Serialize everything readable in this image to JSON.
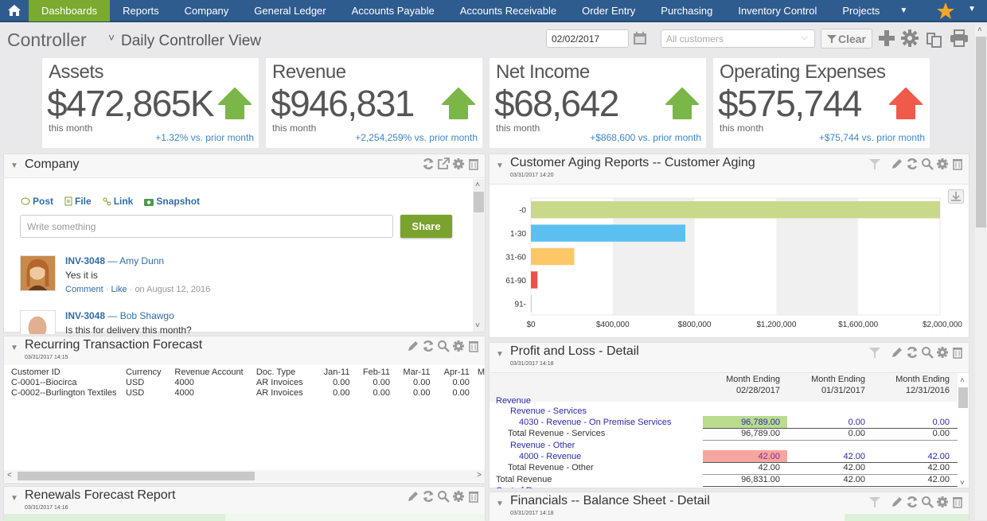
{
  "nav": {
    "home_icon": "home-icon",
    "items": [
      "Dashboards",
      "Reports",
      "Company",
      "General Ledger",
      "Accounts Payable",
      "Accounts Receivable",
      "Order Entry",
      "Purchasing",
      "Inventory Control",
      "Projects"
    ],
    "active": "Dashboards",
    "more_icon": "caret-down-icon",
    "favorites_icon": "star-icon"
  },
  "header": {
    "title": "Controller",
    "view": "Daily Controller View",
    "date": "02/02/2017",
    "customer_filter": "All customers",
    "clear_label": "Clear"
  },
  "kpis": [
    {
      "label": "Assets",
      "value": "$472,865K",
      "sub": "this month",
      "change": "+1.32% vs. prior month",
      "trend": "up",
      "color": "#7ab648"
    },
    {
      "label": "Revenue",
      "value": "$946,831",
      "sub": "this month",
      "change": "+2,254,259% vs. prior month",
      "trend": "up",
      "color": "#7ab648"
    },
    {
      "label": "Net Income",
      "value": "$68,642",
      "sub": "this month",
      "change": "+$868,600 vs. prior month",
      "trend": "up",
      "color": "#7ab648"
    },
    {
      "label": "Operating Expenses",
      "value": "$575,744",
      "sub": "this month",
      "change": "+$75,744 vs. prior month",
      "trend": "up",
      "color": "#f05a4a"
    }
  ],
  "company": {
    "title": "Company",
    "tabs": [
      "Post",
      "File",
      "Link",
      "Snapshot"
    ],
    "placeholder": "Write something",
    "share_label": "Share",
    "posts": [
      {
        "ref": "INV-3048",
        "author": "Amy Dunn",
        "text": "Yes it is",
        "comment": "Comment",
        "like": "Like",
        "date": "on August 12, 2016"
      },
      {
        "ref": "INV-3048",
        "author": "Bob Shawgo",
        "text": "Is this for delivery this month?"
      }
    ]
  },
  "aging": {
    "title": "Customer Aging Reports -- Customer Aging",
    "timestamp": "03/31/2017 14:20"
  },
  "chart_data": {
    "type": "bar",
    "orientation": "horizontal",
    "title": "Customer Aging Reports -- Customer Aging",
    "categories": [
      "-0",
      "1-30",
      "31-60",
      "61-90",
      "91-"
    ],
    "values": [
      2000000,
      755000,
      212000,
      32000,
      2000
    ],
    "colors": [
      "#c9d98a",
      "#5bc0f0",
      "#fdc767",
      "#f0504a",
      "#cccccc"
    ],
    "xlim": [
      0,
      2000000
    ],
    "xticks": [
      "$0",
      "$400,000",
      "$800,000",
      "$1,200,000",
      "$1,600,000",
      "$2,000,000"
    ],
    "xtick_values": [
      0,
      400000,
      800000,
      1200000,
      1600000,
      2000000
    ],
    "xlabel": "",
    "ylabel": "",
    "grid": "alternating vertical bands"
  },
  "recurring": {
    "title": "Recurring Transaction Forecast",
    "timestamp": "03/31/2017 14:15",
    "columns": [
      "Customer ID",
      "Currency",
      "Revenue Account",
      "Doc. Type",
      "Jan-11",
      "Feb-11",
      "Mar-11",
      "Apr-11",
      "M"
    ],
    "rows": [
      [
        "C-0001--Biocirca",
        "USD",
        "4000",
        "AR Invoices",
        "0.00",
        "0.00",
        "0.00",
        "0.00"
      ],
      [
        "C-0002--Burlington Textiles",
        "USD",
        "4000",
        "AR Invoices",
        "0.00",
        "0.00",
        "0.00",
        "0.00"
      ]
    ]
  },
  "renewals": {
    "title": "Renewals Forecast Report",
    "timestamp": "03/31/2017 14:16"
  },
  "pnl": {
    "title": "Profit and Loss - Detail",
    "timestamp": "03/31/2017 14:18",
    "col_head": "Month Ending",
    "columns": [
      "02/28/2017",
      "01/31/2017",
      "12/31/2016"
    ],
    "rows": [
      {
        "label": "Revenue",
        "values": [
          "",
          "",
          ""
        ]
      },
      {
        "label": "Revenue - Services",
        "values": [
          "",
          "",
          ""
        ]
      },
      {
        "label": "4030 - Revenue - On Premise Services",
        "values": [
          "96,789.00",
          "0.00",
          "0.00"
        ]
      },
      {
        "label": "Total Revenue - Services",
        "values": [
          "96,789.00",
          "0.00",
          "0.00"
        ]
      },
      {
        "label": "Revenue - Other",
        "values": [
          "",
          "",
          ""
        ]
      },
      {
        "label": "4000 - Revenue",
        "values": [
          "42.00",
          "42.00",
          "42.00"
        ]
      },
      {
        "label": "Total Revenue - Other",
        "values": [
          "42.00",
          "42.00",
          "42.00"
        ]
      },
      {
        "label": "Total Revenue",
        "values": [
          "96,831.00",
          "42.00",
          "42.00"
        ]
      },
      {
        "label": "Cost of Revenue",
        "values": [
          "",
          "",
          ""
        ]
      }
    ],
    "highlight_good": "#b9dc8f",
    "highlight_bad": "#f6a6a0"
  },
  "balance": {
    "title": "Financials -- Balance Sheet - Detail",
    "timestamp": "03/31/2017 14:18"
  }
}
